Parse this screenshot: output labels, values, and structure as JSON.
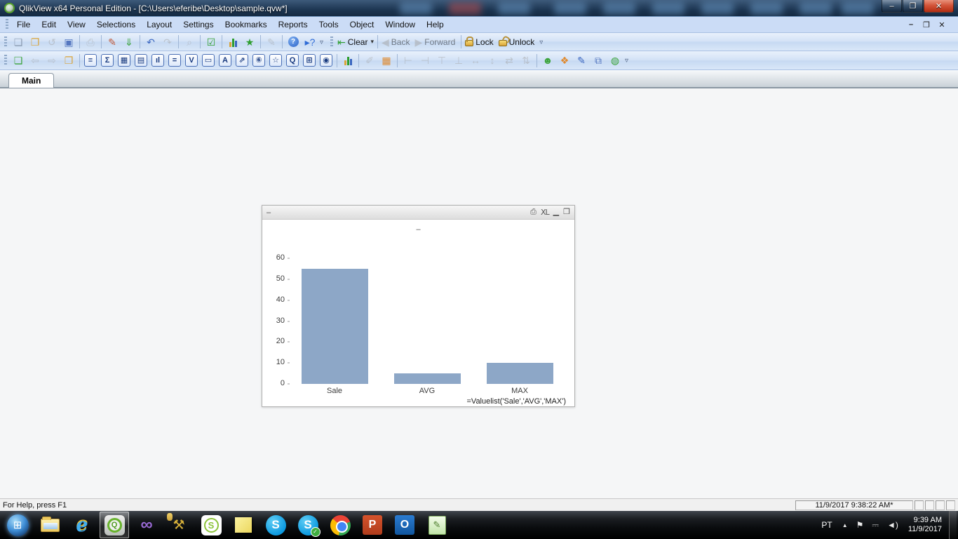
{
  "titlebar": {
    "title": "QlikView x64 Personal Edition - [C:\\Users\\eferibe\\Desktop\\sample.qvw*]",
    "buttons": [
      {
        "id": "window-minimize",
        "glyph": "–"
      },
      {
        "id": "window-restore",
        "glyph": "❐"
      },
      {
        "id": "window-close",
        "glyph": "✕"
      }
    ]
  },
  "menubar": {
    "items": [
      "File",
      "Edit",
      "View",
      "Selections",
      "Layout",
      "Settings",
      "Bookmarks",
      "Reports",
      "Tools",
      "Object",
      "Window",
      "Help"
    ],
    "child_controls": [
      {
        "id": "child-minimize",
        "glyph": "–"
      },
      {
        "id": "child-restore",
        "glyph": "❐"
      },
      {
        "id": "child-close",
        "glyph": "✕"
      }
    ]
  },
  "toolbar_standard": {
    "groups": [
      [
        {
          "id": "new-document",
          "glyph": "❏",
          "color": "#8a9ab0"
        },
        {
          "id": "open-file",
          "glyph": "❐",
          "color": "#d9a43a"
        },
        {
          "id": "refresh-document",
          "glyph": "↺",
          "color": "#9aa6b5",
          "disabled": true
        },
        {
          "id": "save-document",
          "glyph": "▣",
          "color": "#5577c0"
        }
      ],
      [
        {
          "id": "print",
          "glyph": "⎙",
          "color": "#9aa6b5",
          "disabled": true
        }
      ],
      [
        {
          "id": "edit-script",
          "glyph": "✎",
          "color": "#c05a3a"
        },
        {
          "id": "reload-data",
          "glyph": "⇓",
          "color": "#3aa33a"
        }
      ],
      [
        {
          "id": "undo-layout",
          "glyph": "↶",
          "color": "#3a66c0"
        },
        {
          "id": "redo-layout",
          "glyph": "↷",
          "color": "#9aa6b5",
          "disabled": true
        }
      ],
      [
        {
          "id": "search",
          "glyph": "⌕",
          "color": "#9aa6b5",
          "disabled": true
        }
      ],
      [
        {
          "id": "current-selections",
          "glyph": "☑",
          "color": "#2e9e2e"
        }
      ],
      [
        {
          "id": "quick-chart-wizard",
          "type": "bars"
        },
        {
          "id": "add-bookmark",
          "glyph": "★",
          "color": "#2e9e2e"
        }
      ],
      [
        {
          "id": "notes",
          "glyph": "✎",
          "color": "#9aa6b5",
          "disabled": true
        }
      ],
      [
        {
          "id": "help",
          "type": "circle",
          "glyph": "?"
        },
        {
          "id": "context-help",
          "glyph": "▸?",
          "color": "#2e6bd6"
        }
      ]
    ]
  },
  "toolbar_navigation": {
    "groups": [
      [
        {
          "id": "clear-selections",
          "glyph": "⇤",
          "color": "#2e9e2e",
          "label": "Clear",
          "caret": true
        }
      ],
      [
        {
          "id": "back",
          "glyph": "◀",
          "color": "#9aa6b5",
          "label": "Back",
          "disabled": true
        },
        {
          "id": "forward",
          "glyph": "▶",
          "color": "#9aa6b5",
          "label": "Forward",
          "disabled": true
        }
      ],
      [
        {
          "id": "lock-selections",
          "type": "lock",
          "label": "Lock"
        },
        {
          "id": "unlock-selections",
          "type": "lockopen",
          "label": "Unlock"
        }
      ]
    ]
  },
  "toolbar_design": {
    "groups": [
      [
        {
          "id": "add-sheet",
          "glyph": "❏",
          "color": "#3aa33a"
        },
        {
          "id": "promote-sheet",
          "glyph": "⇦",
          "color": "#9aa6b5",
          "disabled": true
        },
        {
          "id": "demote-sheet",
          "glyph": "⇨",
          "color": "#9aa6b5",
          "disabled": true
        },
        {
          "id": "sheet-properties",
          "glyph": "❐",
          "color": "#d9a43a"
        }
      ],
      [
        {
          "id": "create-list-box",
          "type": "obj",
          "glyph": "≡"
        },
        {
          "id": "create-statistics-box",
          "type": "obj",
          "glyph": "Σ"
        },
        {
          "id": "create-table-box",
          "type": "obj",
          "glyph": "▦"
        },
        {
          "id": "create-pivot-table",
          "type": "obj",
          "glyph": "▤"
        },
        {
          "id": "create-chart",
          "type": "obj",
          "glyph": "ıl"
        },
        {
          "id": "create-input-box",
          "type": "obj",
          "glyph": "="
        },
        {
          "id": "create-multi-box",
          "type": "obj",
          "glyph": "V"
        },
        {
          "id": "create-slider-object",
          "type": "obj",
          "glyph": "▭"
        },
        {
          "id": "create-text-object",
          "type": "obj",
          "glyph": "A"
        },
        {
          "id": "create-line-arrow-object",
          "type": "obj",
          "glyph": "⇗"
        },
        {
          "id": "create-button-object",
          "type": "obj",
          "glyph": "⑥"
        },
        {
          "id": "create-bookmark-object",
          "type": "obj",
          "glyph": "☆"
        },
        {
          "id": "create-search-object",
          "type": "obj",
          "glyph": "Q"
        },
        {
          "id": "create-container-object",
          "type": "obj",
          "glyph": "⊞"
        },
        {
          "id": "create-custom-object",
          "type": "obj",
          "glyph": "◉"
        }
      ],
      [
        {
          "id": "quick-chart-wizard-design",
          "type": "bars"
        }
      ],
      [
        {
          "id": "format-painter",
          "glyph": "✐",
          "color": "#9aa6b5",
          "disabled": true
        },
        {
          "id": "design-grid",
          "glyph": "▦",
          "color": "#e08a2e"
        }
      ],
      [
        {
          "id": "align-left",
          "glyph": "⊢",
          "color": "#9aa6b5",
          "disabled": true
        },
        {
          "id": "align-center-horizontal",
          "glyph": "⊣",
          "color": "#9aa6b5",
          "disabled": true
        },
        {
          "id": "align-top",
          "glyph": "⊤",
          "color": "#9aa6b5",
          "disabled": true
        },
        {
          "id": "align-bottom",
          "glyph": "⊥",
          "color": "#9aa6b5",
          "disabled": true
        },
        {
          "id": "space-horizontally",
          "glyph": "↔",
          "color": "#9aa6b5",
          "disabled": true
        },
        {
          "id": "space-vertically",
          "glyph": "↕",
          "color": "#9aa6b5",
          "disabled": true
        },
        {
          "id": "adjust-left",
          "glyph": "⇄",
          "color": "#9aa6b5",
          "disabled": true
        },
        {
          "id": "adjust-top",
          "glyph": "⇅",
          "color": "#9aa6b5",
          "disabled": true
        }
      ],
      [
        {
          "id": "user-preferences",
          "glyph": "☻",
          "color": "#3aa33a"
        },
        {
          "id": "document-properties",
          "glyph": "❖",
          "color": "#e08a2e"
        },
        {
          "id": "edit-module",
          "glyph": "✎",
          "color": "#3a66c0"
        },
        {
          "id": "table-viewer",
          "glyph": "⧉",
          "color": "#5577c0"
        },
        {
          "id": "web-page",
          "glyph": "◍",
          "color": "#3aa33a"
        }
      ]
    ]
  },
  "tabs": [
    {
      "label": "Main",
      "active": true
    }
  ],
  "chart_window": {
    "caption_title": "–",
    "caption_icons": [
      {
        "id": "print-chart",
        "glyph": "⎙"
      },
      {
        "id": "export-to-excel",
        "glyph": "XL"
      },
      {
        "id": "minimize-chart",
        "glyph": "▁"
      },
      {
        "id": "maximize-chart",
        "glyph": "❒"
      }
    ]
  },
  "chart_data": {
    "type": "bar",
    "title": "–",
    "categories": [
      "Sale",
      "AVG",
      "MAX"
    ],
    "values": [
      55,
      5,
      10
    ],
    "xlabel": "=Valuelist('Sale','AVG','MAX')",
    "ylabel": "",
    "ylim": [
      0,
      60
    ],
    "yticks": [
      0,
      10,
      20,
      30,
      40,
      50,
      60
    ],
    "bar_color": "#8da7c7",
    "grid": false,
    "legend": "none"
  },
  "statusbar": {
    "help_text": "For Help, press F1",
    "timestamp": "11/9/2017 9:38:22 AM*",
    "extra_panels": 4
  },
  "taskbar": {
    "items": [
      {
        "id": "start-button",
        "style": "start",
        "glyph": "⊞"
      },
      {
        "id": "taskbar-windows-explorer",
        "style": "explorer"
      },
      {
        "id": "taskbar-internet-explorer",
        "style": "ie",
        "glyph": "e"
      },
      {
        "id": "taskbar-qlikview",
        "style": "qlik",
        "glyph": "Q",
        "active": true
      },
      {
        "id": "taskbar-visual-studio",
        "style": "vs",
        "glyph": "∞"
      },
      {
        "id": "taskbar-sql-tools",
        "style": "tools",
        "glyph": "⚒"
      },
      {
        "id": "taskbar-skype-business",
        "style": "sfb",
        "glyph": "S"
      },
      {
        "id": "taskbar-sticky-notes",
        "style": "notes"
      },
      {
        "id": "taskbar-skype",
        "style": "skype",
        "glyph": "S"
      },
      {
        "id": "taskbar-skype-signed-in",
        "style": "skype2",
        "glyph": "S"
      },
      {
        "id": "taskbar-chrome",
        "style": "chrome"
      },
      {
        "id": "taskbar-powerpoint",
        "style": "ppt",
        "glyph": "P"
      },
      {
        "id": "taskbar-outlook",
        "style": "outlook",
        "glyph": "O"
      },
      {
        "id": "taskbar-notepad-plus-plus",
        "style": "npp",
        "glyph": "✎"
      }
    ],
    "tray": {
      "language": "PT",
      "icons": [
        {
          "id": "tray-expand",
          "glyph": "▲",
          "cls": "up"
        },
        {
          "id": "tray-action-center",
          "glyph": "⚑"
        },
        {
          "id": "tray-power",
          "glyph": "⎓"
        },
        {
          "id": "tray-volume",
          "glyph": "◄)"
        }
      ],
      "time": "9:39 AM",
      "date": "11/9/2017"
    }
  }
}
